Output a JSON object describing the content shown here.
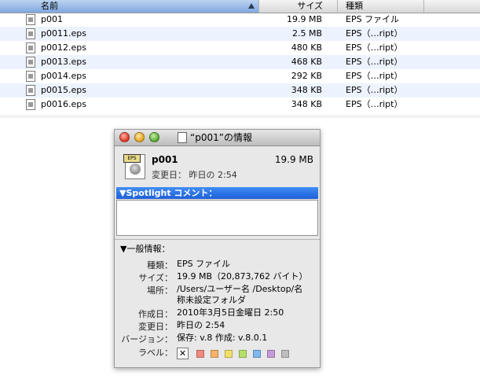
{
  "list": {
    "headers": {
      "name": "名前",
      "size": "サイズ",
      "kind": "種類"
    },
    "rows": [
      {
        "name": "p001",
        "size": "19.9 MB",
        "kind": "EPS ファイル"
      },
      {
        "name": "p0011.eps",
        "size": "2.5 MB",
        "kind": "EPS（…ript）"
      },
      {
        "name": "p0012.eps",
        "size": "480 KB",
        "kind": "EPS（…ript）"
      },
      {
        "name": "p0013.eps",
        "size": "468 KB",
        "kind": "EPS（…ript）"
      },
      {
        "name": "p0014.eps",
        "size": "292 KB",
        "kind": "EPS（…ript）"
      },
      {
        "name": "p0015.eps",
        "size": "348 KB",
        "kind": "EPS（…ript）"
      },
      {
        "name": "p0016.eps",
        "size": "348 KB",
        "kind": "EPS（…ript）"
      }
    ]
  },
  "info": {
    "title": "“p001”の情報",
    "file_name": "p001",
    "file_size": "19.9 MB",
    "modified_line": "変更日：  昨日の 2:54",
    "icon_tag": "EPS",
    "spotlight_label": "▼Spotlight コメント：",
    "general_label": "▼一般情報：",
    "rows": [
      {
        "key": "種類：",
        "value": "EPS ファイル"
      },
      {
        "key": "サイズ：",
        "value": "19.9 MB（20,873,762 バイト）"
      },
      {
        "key": "場所：",
        "value": "/Users/ユーザー名 /Desktop/名称未設定フォルダ"
      },
      {
        "key": "作成日：",
        "value": "2010年3月5日金曜日 2:50"
      },
      {
        "key": "変更日：",
        "value": "昨日の 2:54"
      },
      {
        "key": "バージョン：",
        "value": "保存: v.8 作成: v.8.0.1"
      }
    ],
    "label_key": "ラベル：",
    "label_none": "✕",
    "label_colors": [
      "#f28a7f",
      "#f6b36a",
      "#f2df6a",
      "#b7df66",
      "#7fb7f0",
      "#c79ad9",
      "#bdbdbd"
    ]
  }
}
